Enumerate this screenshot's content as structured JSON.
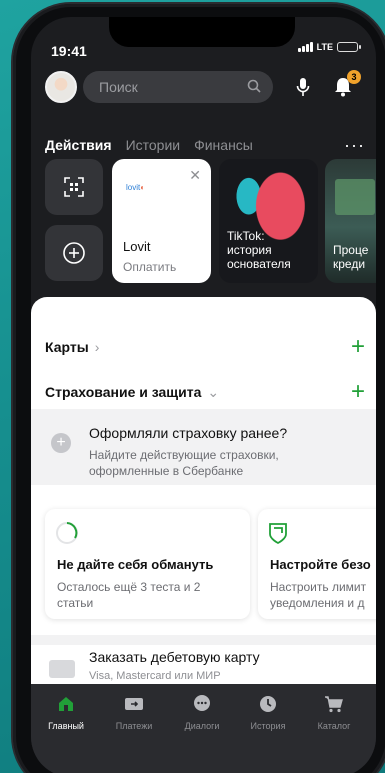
{
  "status_bar": {
    "time": "19:41",
    "network": "LTE",
    "battery_level": 0.35
  },
  "header": {
    "search_placeholder": "Поиск",
    "notification_count": "3"
  },
  "tabs": [
    {
      "label": "Действия",
      "active": true
    },
    {
      "label": "Истории",
      "active": false
    },
    {
      "label": "Финансы",
      "active": false
    }
  ],
  "quick_actions": [
    {
      "icon": "qr-scan-icon"
    },
    {
      "icon": "plus-circle-icon"
    }
  ],
  "stories": [
    {
      "logo": "lovit",
      "title": "Lovit",
      "subtitle": "Оплатить"
    },
    {
      "title_line1": "TikTok:",
      "title_line2": "история",
      "title_line3": "основателя"
    },
    {
      "title_line1": "Проце",
      "title_line2": "креди"
    }
  ],
  "sections": {
    "cards": {
      "label": "Карты",
      "chevron": "›"
    },
    "insurance": {
      "label": "Страхование и защита",
      "chevron": "⌄"
    }
  },
  "insurance_banner": {
    "title": "Оформляли страховку ранее?",
    "subtitle": "Найдите действующие страховки, оформленные в Сбербанке"
  },
  "tips": [
    {
      "title": "Не дайте себя обмануть",
      "line1": "Осталось ещё 3 теста и 2",
      "line2": "статьи"
    },
    {
      "title": "Настройте безо",
      "line1": "Настроить лимит",
      "line2": "уведомления и д"
    }
  ],
  "debit_offer": {
    "title": "Заказать дебетовую карту",
    "subtitle": "Visa, Mastercard или МИР"
  },
  "bottom_nav": [
    {
      "label": "Главный",
      "icon": "home-icon",
      "active": true
    },
    {
      "label": "Платежи",
      "icon": "payments-icon",
      "active": false
    },
    {
      "label": "Диалоги",
      "icon": "chat-icon",
      "active": false
    },
    {
      "label": "История",
      "icon": "clock-icon",
      "active": false
    },
    {
      "label": "Каталог",
      "icon": "cart-icon",
      "active": false
    }
  ],
  "colors": {
    "accent": "#21a038",
    "badge": "#f0a22b",
    "background": "#1c1d20"
  }
}
